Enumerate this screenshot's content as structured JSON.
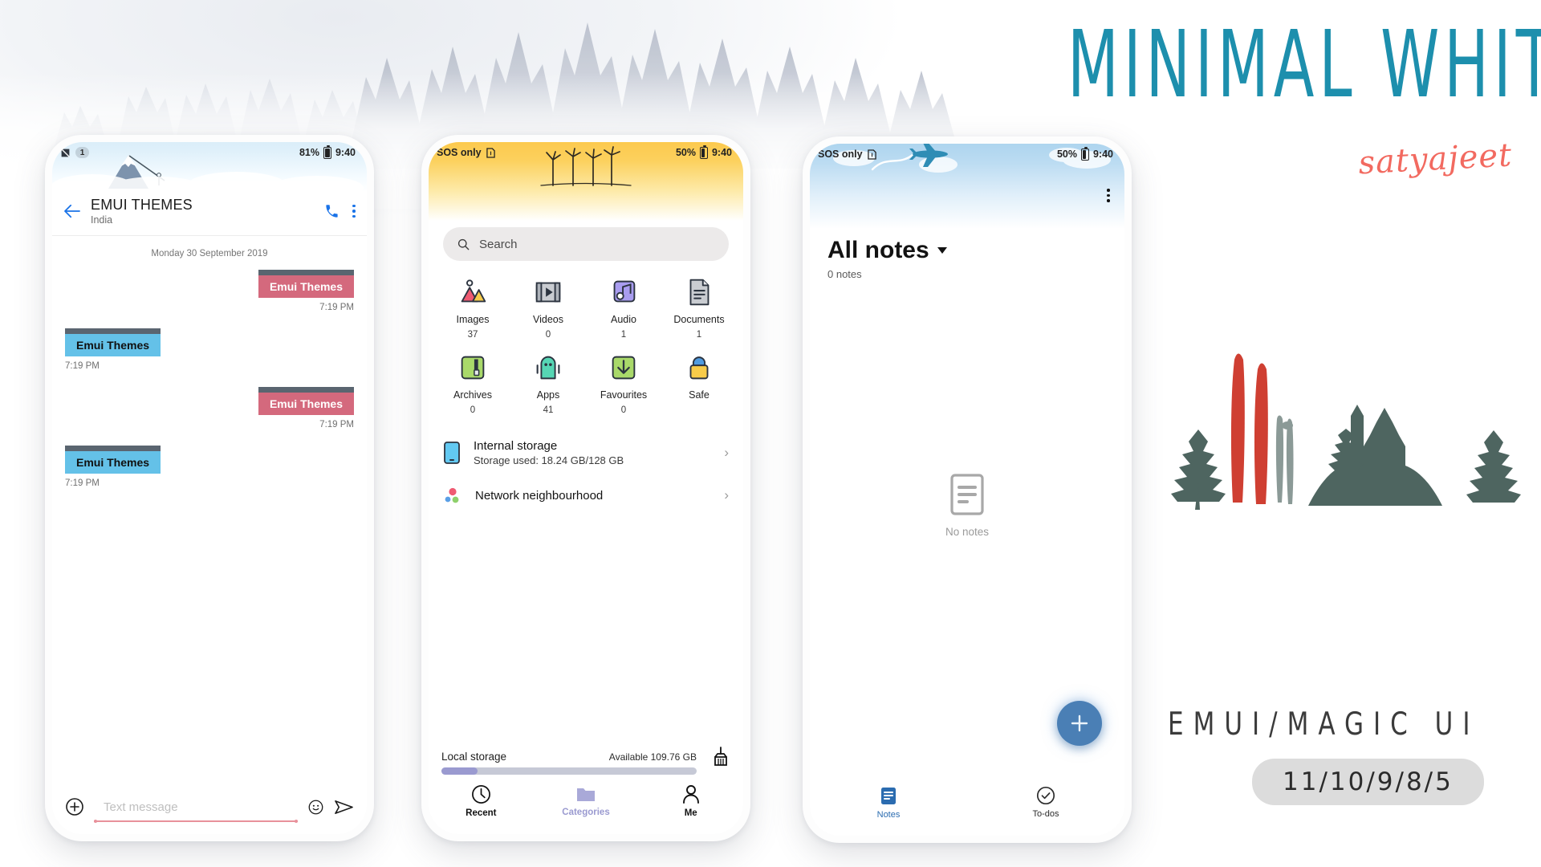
{
  "branding": {
    "title": "MINIMAL WHITE",
    "signature": "satyajeet",
    "platform_label": "EMUI/MAGIC UI",
    "versions": "11/10/9/8/5",
    "accent_teal": "#1d8fad",
    "accent_coral": "#f26a60",
    "tree_green": "#4e6560",
    "ski_red": "#cf3f32"
  },
  "phone1": {
    "app": "Messages",
    "statusbar": {
      "badge": "1",
      "battery": "81%",
      "time": "9:40",
      "signal_icon": "no-sim-icon"
    },
    "appbar": {
      "back_icon": "back-arrow-icon",
      "title": "EMUI THEMES",
      "subtitle": "India",
      "call_icon": "phone-call-icon",
      "overflow_icon": "more-vertical-icon"
    },
    "daystamp": "Monday 30 September 2019",
    "messages": [
      {
        "text": "Emui Themes",
        "time": "7:19 PM",
        "side": "out"
      },
      {
        "text": "Emui Themes",
        "time": "7:19 PM",
        "side": "in"
      },
      {
        "text": "Emui Themes",
        "time": "7:19 PM",
        "side": "out"
      },
      {
        "text": "Emui Themes",
        "time": "7:19 PM",
        "side": "in"
      }
    ],
    "composer": {
      "add_icon": "plus-circle-icon",
      "placeholder": "Text message",
      "emoji_icon": "smiley-icon",
      "send_icon": "send-icon"
    },
    "bubble_in_color": "#64c1e8",
    "bubble_out_color": "#d4697d",
    "bubble_cap_color": "#5a6570"
  },
  "phone2": {
    "app": "Files",
    "statusbar": {
      "network": "SOS only",
      "sim_icon": "sim-card-icon",
      "battery": "50%",
      "time": "9:40"
    },
    "search": {
      "icon": "search-icon",
      "placeholder": "Search"
    },
    "categories": [
      {
        "name": "Images",
        "count": "37",
        "icon": "images-icon"
      },
      {
        "name": "Videos",
        "count": "0",
        "icon": "video-icon"
      },
      {
        "name": "Audio",
        "count": "1",
        "icon": "audio-icon"
      },
      {
        "name": "Documents",
        "count": "1",
        "icon": "document-icon"
      },
      {
        "name": "Archives",
        "count": "0",
        "icon": "archive-icon"
      },
      {
        "name": "Apps",
        "count": "41",
        "icon": "apps-icon"
      },
      {
        "name": "Favourites",
        "count": "0",
        "icon": "download-icon"
      },
      {
        "name": "Safe",
        "count": "",
        "icon": "lock-icon"
      }
    ],
    "storage_rows": [
      {
        "title": "Internal storage",
        "subtitle": "Storage used: 18.24 GB/128 GB",
        "icon": "phone-icon",
        "chevron": "chevron-right-icon"
      },
      {
        "title": "Network neighbourhood",
        "subtitle": "",
        "icon": "network-icon",
        "chevron": "chevron-right-icon"
      }
    ],
    "local_storage": {
      "label": "Local storage",
      "available": "Available 109.76 GB",
      "used_percent": 14,
      "clean_icon": "broom-icon"
    },
    "nav": [
      {
        "label": "Recent",
        "icon": "clock-icon",
        "active": false
      },
      {
        "label": "Categories",
        "icon": "folder-icon",
        "active": true
      },
      {
        "label": "Me",
        "icon": "person-icon",
        "active": false
      }
    ]
  },
  "phone3": {
    "app": "Notes",
    "statusbar": {
      "network": "SOS only",
      "sim_icon": "sim-card-icon",
      "battery": "50%",
      "time": "9:40"
    },
    "overflow_icon": "more-vertical-icon",
    "title": "All notes",
    "dropdown_icon": "caret-down-icon",
    "count": "0 notes",
    "empty": {
      "icon": "note-page-icon",
      "label": "No notes"
    },
    "fab": {
      "icon": "plus-icon",
      "color": "#4a7fb5"
    },
    "nav": [
      {
        "label": "Notes",
        "icon": "notes-icon",
        "active": true
      },
      {
        "label": "To-dos",
        "icon": "check-circle-icon",
        "active": false
      }
    ]
  }
}
